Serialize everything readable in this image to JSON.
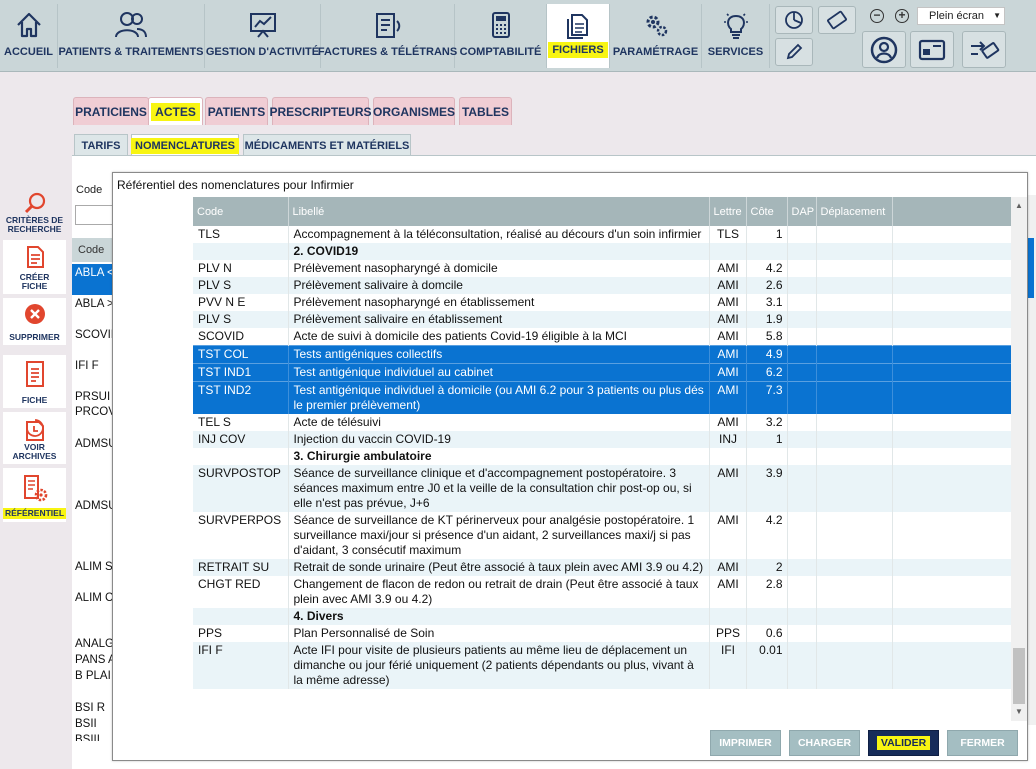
{
  "toolbar": {
    "nav": [
      {
        "label": "ACCUEIL",
        "icon": "home-icon"
      },
      {
        "label": "PATIENTS & TRAITEMENTS",
        "icon": "users-icon"
      },
      {
        "label": "GESTION D'ACTIVITÉ",
        "icon": "chart-board-icon"
      },
      {
        "label": "FACTURES & TÉLÉTRANS",
        "icon": "invoice-icon"
      },
      {
        "label": "COMPTABILITÉ",
        "icon": "calculator-icon"
      },
      {
        "label": "FICHIERS",
        "icon": "files-icon"
      },
      {
        "label": "PARAMÉTRAGE",
        "icon": "gears-icon"
      },
      {
        "label": "SERVICES",
        "icon": "lightbulb-icon"
      }
    ],
    "active_nav": "FICHIERS",
    "fullscreen_select": "Plein écran"
  },
  "tabs": [
    "PRATICIENS",
    "ACTES",
    "PATIENTS",
    "PRESCRIPTEURS",
    "ORGANISMES",
    "TABLES"
  ],
  "active_tab": "ACTES",
  "subtabs": [
    "TARIFS",
    "NOMENCLATURES",
    "MÉDICAMENTS ET MATÉRIELS"
  ],
  "active_subtab": "NOMENCLATURES",
  "sidebar": [
    {
      "label1": "CRITÈRES DE",
      "label2": "RECHERCHE",
      "icon": "search-icon"
    },
    {
      "label1": "CRÉER",
      "label2": "FICHE",
      "icon": "create-file-icon"
    },
    {
      "label1": "SUPPRIMER",
      "label2": "",
      "icon": "delete-icon"
    },
    {
      "label1": "FICHE",
      "label2": "",
      "icon": "file-icon"
    },
    {
      "label1": "VOIR",
      "label2": "ARCHIVES",
      "icon": "archive-icon"
    },
    {
      "label1": "RÉFÉRENTIEL",
      "label2": "",
      "icon": "referential-icon"
    }
  ],
  "background": {
    "code_label": "Code",
    "column_header": "Code",
    "items": [
      "ABLA <",
      "ABLA >",
      "SCOVII",
      "IFI F",
      "PRSUI",
      "PRCOV",
      "ADMSU",
      "ADMSU",
      "ALIM S",
      "ALIM C",
      "ANALG",
      "PANS A",
      "B PLAI",
      "BSI R",
      "BSII",
      "BSIII"
    ]
  },
  "dialog": {
    "title": "Référentiel des nomenclatures pour Infirmier",
    "columns": [
      "Code",
      "Libellé",
      "Lettre",
      "Côte",
      "DAP",
      "Déplacement"
    ],
    "rows": [
      {
        "code": "TLS",
        "label": "Accompagnement à la téléconsultation, réalisé au décours d'un soin infirmier",
        "lettre": "TLS",
        "cote": "1"
      },
      {
        "section": "2. COVID19"
      },
      {
        "code": "PLV N",
        "label": "Prélèvement nasopharyngé à domicile",
        "lettre": "AMI",
        "cote": "4.2"
      },
      {
        "code": "PLV S",
        "label": "Prélèvement salivaire à domcile",
        "lettre": "AMI",
        "cote": "2.6"
      },
      {
        "code": "PVV N E",
        "label": "Prélèvement nasopharyngé en établissement",
        "lettre": "AMI",
        "cote": "3.1"
      },
      {
        "code": "PLV S",
        "label": "Prélèvement salivaire en établissement",
        "lettre": "AMI",
        "cote": "1.9"
      },
      {
        "code": "SCOVID",
        "label": "Acte de suivi à domicile des patients Covid-19 éligible à la MCI",
        "lettre": "AMI",
        "cote": "5.8"
      },
      {
        "code": "TST COL",
        "label": "Tests antigéniques collectifs",
        "lettre": "AMI",
        "cote": "4.9",
        "selected": true
      },
      {
        "code": "TST IND1",
        "label": "Test antigénique individuel au cabinet",
        "lettre": "AMI",
        "cote": "6.2",
        "selected": true
      },
      {
        "code": "TST IND2",
        "label": "Test antigénique individuel à domicile (ou AMI 6.2 pour 3 patients ou plus dés le premier prélèvement)",
        "lettre": "AMI",
        "cote": "7.3",
        "selected": true
      },
      {
        "code": "TEL S",
        "label": "Acte de télésuivi",
        "lettre": "AMI",
        "cote": "3.2"
      },
      {
        "code": "INJ COV",
        "label": "Injection du vaccin COVID-19",
        "lettre": "INJ",
        "cote": "1"
      },
      {
        "section": "3. Chirurgie ambulatoire"
      },
      {
        "code": "SURVPOSTOP",
        "label": "Séance de surveillance clinique et d'accompagnement postopératoire. 3 séances maximum entre J0 et la veille de la consultation chir post-op ou, si elle n'est pas prévue, J+6",
        "lettre": "AMI",
        "cote": "3.9"
      },
      {
        "code": "SURVPERPOS",
        "label": "Séance de surveillance de KT périnerveux pour analgésie postopératoire. 1 surveillance maxi/jour si présence d'un aidant, 2 surveillances maxi/j si pas d'aidant, 3 consécutif maximum",
        "lettre": "AMI",
        "cote": "4.2"
      },
      {
        "code": "RETRAIT SU",
        "label": "Retrait de sonde urinaire (Peut être associé à taux plein avec AMI 3.9 ou 4.2)",
        "lettre": "AMI",
        "cote": "2"
      },
      {
        "code": "CHGT RED",
        "label": "Changement de flacon de redon ou retrait de drain (Peut être associé à taux plein avec AMI 3.9 ou 4.2)",
        "lettre": "AMI",
        "cote": "2.8"
      },
      {
        "section": "4. Divers"
      },
      {
        "code": "PPS",
        "label": "Plan Personnalisé de Soin",
        "lettre": "PPS",
        "cote": "0.6"
      },
      {
        "code": "IFI F",
        "label": "Acte IFI pour visite de plusieurs patients au même lieu de déplacement un dimanche ou jour férié uniquement (2 patients dépendants ou plus, vivant à la même adresse)",
        "lettre": "IFI",
        "cote": "0.01"
      }
    ],
    "buttons": [
      "IMPRIMER",
      "CHARGER",
      "VALIDER",
      "FERMER"
    ]
  }
}
